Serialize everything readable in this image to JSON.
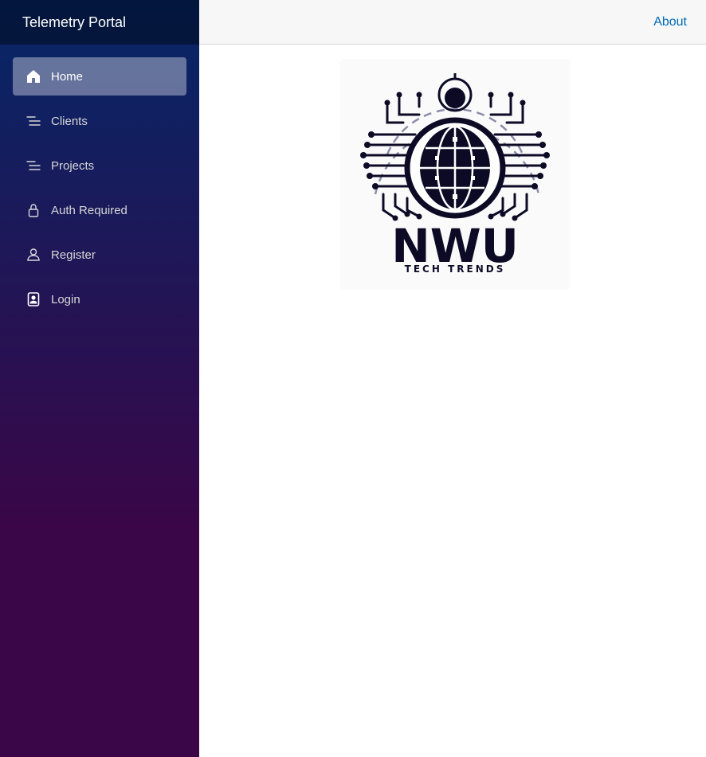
{
  "sidebar": {
    "brand": "Telemetry Portal",
    "items": [
      {
        "label": "Home",
        "icon": "home-icon",
        "active": true
      },
      {
        "label": "Clients",
        "icon": "list-icon",
        "active": false
      },
      {
        "label": "Projects",
        "icon": "list-icon",
        "active": false
      },
      {
        "label": "Auth Required",
        "icon": "lock-icon",
        "active": false
      },
      {
        "label": "Register",
        "icon": "person-icon",
        "active": false
      },
      {
        "label": "Login",
        "icon": "badge-icon",
        "active": false
      }
    ]
  },
  "topbar": {
    "about_label": "About"
  },
  "main": {
    "logo": {
      "title": "NWU",
      "subtitle": "TECH TRENDS"
    }
  },
  "colors": {
    "sidebar_top": "#052767",
    "sidebar_bottom": "#3a0647",
    "link": "#006bb7",
    "logo_dark": "#0d0a26"
  }
}
